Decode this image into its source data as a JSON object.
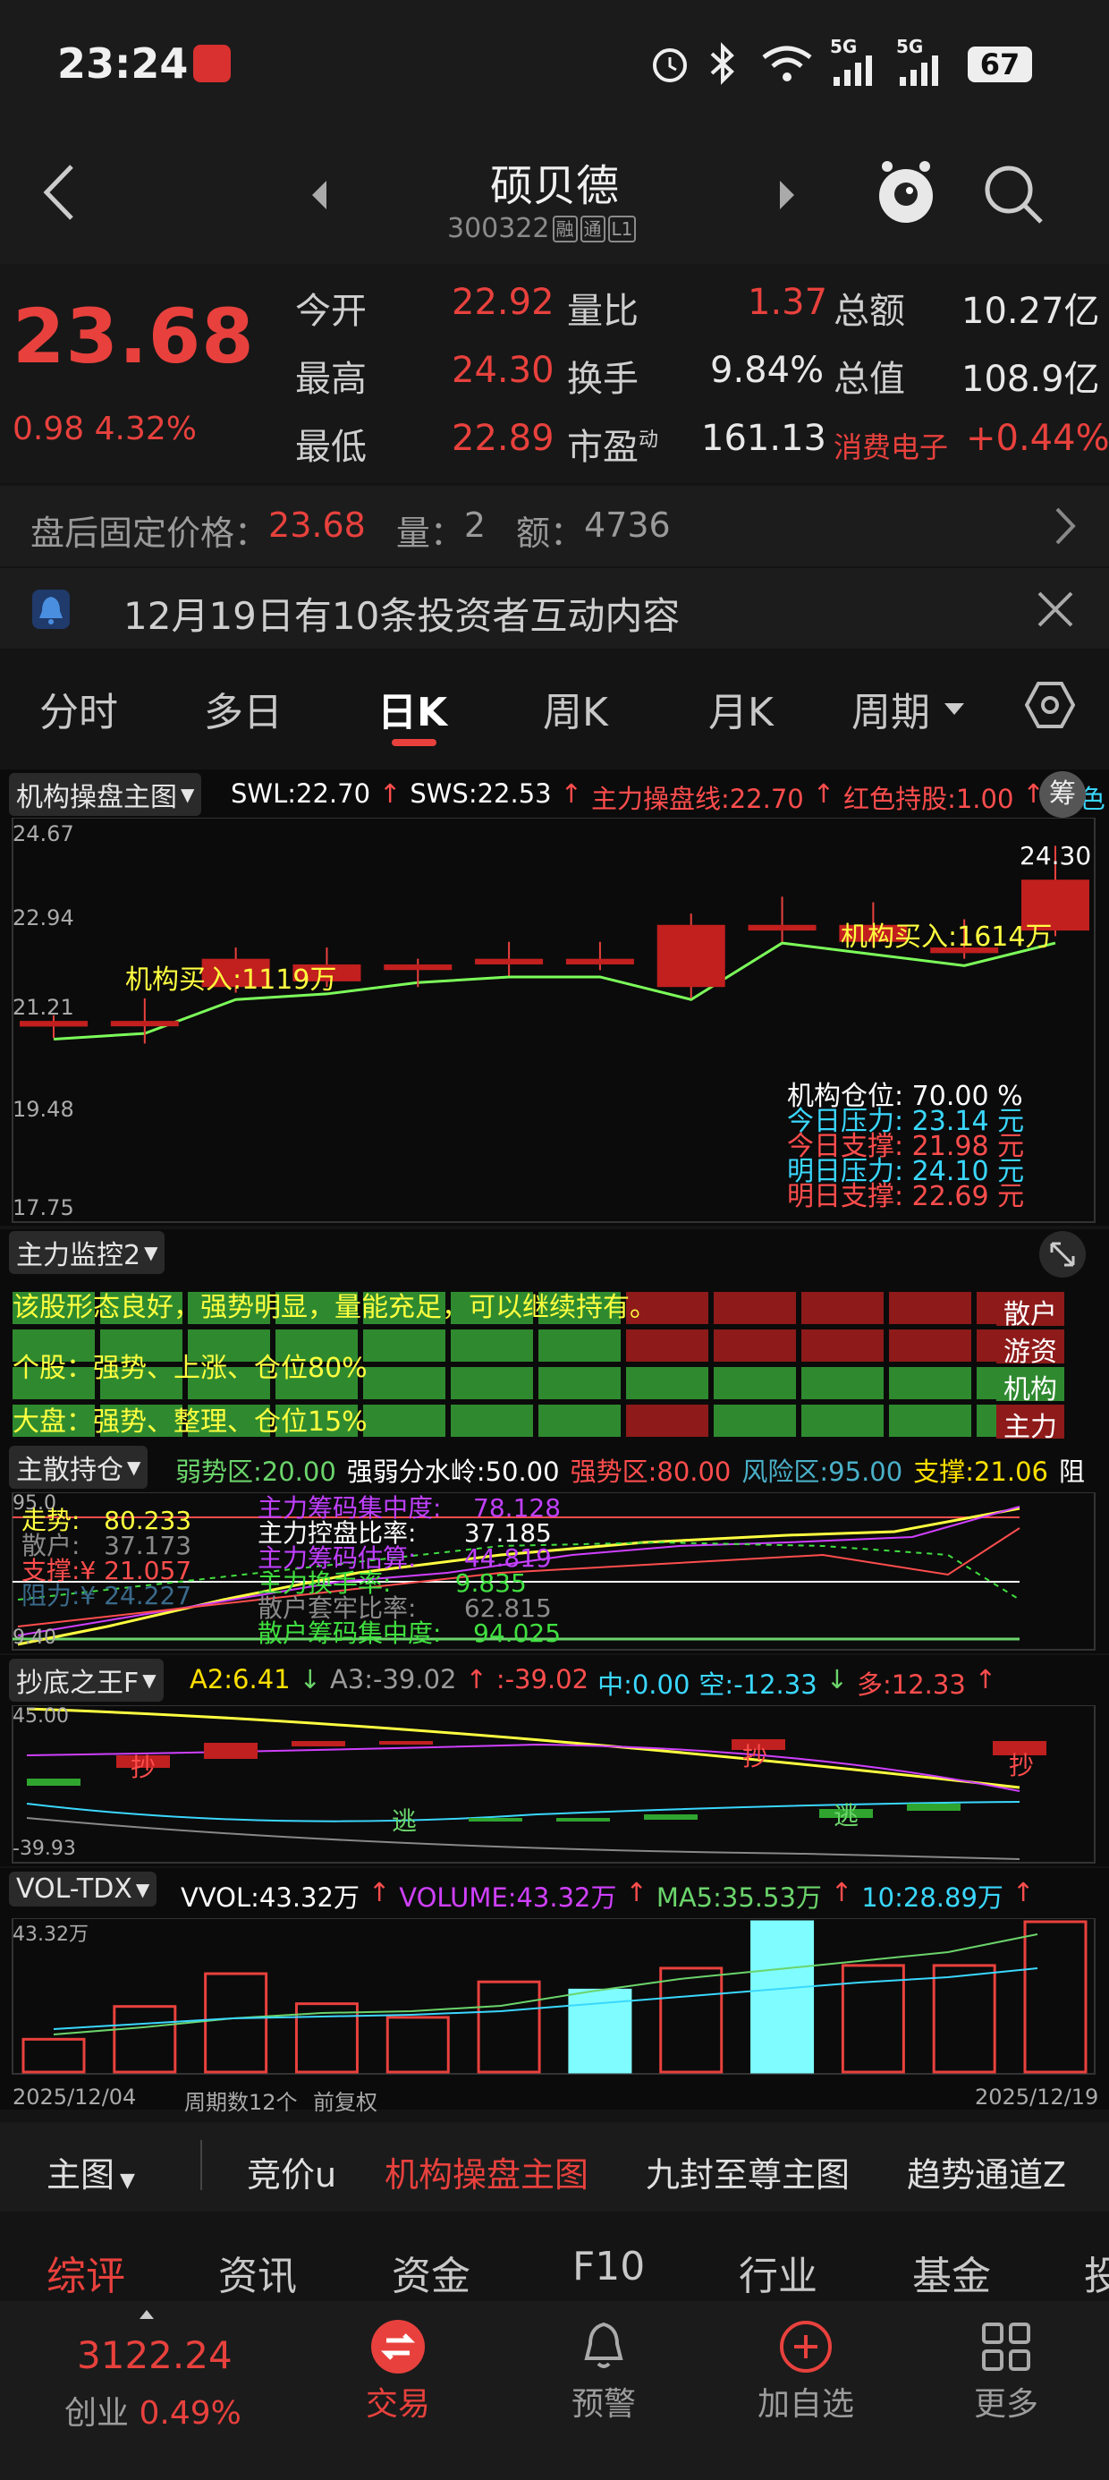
{
  "status_bar": {
    "time": "23:24",
    "battery": "67",
    "net1": "5G",
    "net2": "5G"
  },
  "header": {
    "stock_name": "硕贝德",
    "stock_code": "300322",
    "badges": [
      "融",
      "通",
      "L1"
    ]
  },
  "quote": {
    "price": "23.68",
    "change": "0.98",
    "change_pct": "4.32%",
    "fields": [
      {
        "label": "今开",
        "value": "22.92"
      },
      {
        "label": "量比",
        "value": "1.37"
      },
      {
        "label": "总额",
        "value": "10.27亿"
      },
      {
        "label": "最高",
        "value": "24.30"
      },
      {
        "label": "换手",
        "value": "9.84%"
      },
      {
        "label": "总值",
        "value": "108.9亿"
      },
      {
        "label": "最低",
        "value": "22.89"
      },
      {
        "label": "市盈",
        "value": "161.13"
      },
      {
        "label": "消费电子",
        "value": "+0.44%"
      }
    ],
    "pe_sup": "动"
  },
  "after_hours": {
    "label": "盘后固定价格：",
    "price": "23.68",
    "vol_label": "量：",
    "vol": "2",
    "amt_label": "额：",
    "amt": "4736"
  },
  "notice": {
    "text": "12月19日有10条投资者互动内容"
  },
  "tabs": [
    "分时",
    "多日",
    "日K",
    "周K",
    "月K",
    "周期"
  ],
  "main_chart": {
    "indicator": "机构操盘主图",
    "legend": [
      {
        "text": "SWL:22.70",
        "color": "#ffffff"
      },
      {
        "text": "SWS:22.53",
        "color": "#ffffff"
      },
      {
        "text": "主力操盘线:22.70",
        "color": "#ff4d4d"
      },
      {
        "text": "红色持股:1.00",
        "color": "#ff4d4d"
      },
      {
        "text": "青色",
        "color": "#3ad8ff"
      }
    ],
    "chip_label": "筹",
    "y_ticks": [
      "24.67",
      "22.94",
      "21.21",
      "19.48",
      "17.75"
    ],
    "high_label": "24.30",
    "buy_label_1": "机构买入:1119万",
    "buy_label_2": "机构买入:1614万",
    "info": [
      {
        "label": "机构仓位:",
        "value": "70.00 %",
        "color": "#ffffff"
      },
      {
        "label": "今日压力:",
        "value": "23.14 元",
        "color": "#3ad8ff"
      },
      {
        "label": "今日支撑:",
        "value": "21.98 元",
        "color": "#ff4d4d"
      },
      {
        "label": "明日压力:",
        "value": "24.10 元",
        "color": "#3ad8ff"
      },
      {
        "label": "明日支撑:",
        "value": "22.69 元",
        "color": "#ff4d4d"
      }
    ]
  },
  "chart_data": {
    "type": "candlestick",
    "dates_shown": [
      "2025/12/04",
      "2025/12/19"
    ],
    "period_count_label": "周期数12个",
    "adjust_label": "前复权",
    "ylim": [
      17.75,
      24.67
    ],
    "candles": [
      {
        "o": 21.1,
        "c": 21.2,
        "h": 21.3,
        "l": 20.9
      },
      {
        "o": 21.2,
        "c": 21.2,
        "h": 21.6,
        "l": 20.8
      },
      {
        "o": 21.8,
        "c": 22.3,
        "h": 22.5,
        "l": 21.7
      },
      {
        "o": 21.9,
        "c": 22.2,
        "h": 22.5,
        "l": 21.8
      },
      {
        "o": 22.1,
        "c": 22.2,
        "h": 22.3,
        "l": 21.8
      },
      {
        "o": 22.2,
        "c": 22.3,
        "h": 22.6,
        "l": 22.0
      },
      {
        "o": 22.2,
        "c": 22.3,
        "h": 22.6,
        "l": 22.1
      },
      {
        "o": 21.8,
        "c": 22.9,
        "h": 23.1,
        "l": 21.6
      },
      {
        "o": 22.8,
        "c": 22.9,
        "h": 23.4,
        "l": 22.6
      },
      {
        "o": 22.6,
        "c": 22.9,
        "h": 23.3,
        "l": 22.5
      },
      {
        "o": 22.4,
        "c": 22.5,
        "h": 23.0,
        "l": 22.3
      },
      {
        "o": 22.8,
        "c": 23.7,
        "h": 24.3,
        "l": 22.7
      }
    ],
    "volume": [
      12,
      24,
      36,
      25,
      20,
      33,
      30,
      38,
      55,
      39,
      39,
      55
    ]
  },
  "monitor": {
    "indicator": "主力监控2",
    "text1": "该股形态良好，强势明显，量能充足，可以继续持有。",
    "text2": "个股：强势、上涨、仓位80%",
    "text3": "大盘：强势、整理、仓位15%",
    "labels": [
      "散户",
      "游资",
      "机构",
      "主力"
    ]
  },
  "holdings": {
    "indicator": "主散持仓",
    "legend": [
      {
        "text": "弱势区:20.00",
        "color": "#6bd46b"
      },
      {
        "text": "强弱分水岭:50.00",
        "color": "#ffffff"
      },
      {
        "text": "强势区:80.00",
        "color": "#ff4d4d"
      },
      {
        "text": "风险区:95.00",
        "color": "#4ab0c8"
      },
      {
        "text": "支撑:21.06",
        "color": "#ffe000"
      },
      {
        "text": "阻",
        "color": "#ffffff"
      }
    ],
    "y_top": "95.0",
    "y_bottom": "9.40",
    "rows": [
      {
        "label": "走势:",
        "value": "80.233",
        "color": "#ffff40"
      },
      {
        "label": "散户:",
        "value": "37.173",
        "color": "#8a8a8a"
      },
      {
        "label": "支撑:¥",
        "value": "21.057",
        "color": "#ff4d4d"
      },
      {
        "label": "阻力:¥",
        "value": "24.227",
        "color": "#3a6a8a"
      }
    ],
    "mid": [
      {
        "label": "主力筹码集中度:",
        "value": "78.128",
        "color": "#c040ff"
      },
      {
        "label": "主力控盘比率:",
        "value": "37.185",
        "color": "#ffffff"
      },
      {
        "label": "主力筹码估算:",
        "value": "44.819",
        "color": "#c040ff"
      },
      {
        "label": "主力换手率:",
        "value": "9.835",
        "color": "#40e040"
      },
      {
        "label": "散户套牢比率:",
        "value": "62.815",
        "color": "#8a8a8a"
      },
      {
        "label": "散户筹码集中度:",
        "value": "94.025",
        "color": "#40e040"
      }
    ]
  },
  "bottom_pick": {
    "indicator": "抄底之王F",
    "legend": [
      {
        "text": "A2:6.41",
        "color": "#ffe000"
      },
      {
        "text": "A3:-39.02",
        "color": "#9a9a9a"
      },
      {
        "text": ":-39.02",
        "color": "#ff4d4d"
      },
      {
        "text": "中:0.00",
        "color": "#3ad8ff"
      },
      {
        "text": "空:-12.33",
        "color": "#3ad8ff"
      },
      {
        "text": "多:12.33",
        "color": "#ff4d4d"
      }
    ],
    "y_top": "45.00",
    "y_bottom": "-39.93",
    "buy_mark": "抄",
    "escape_mark": "逃"
  },
  "vol_panel": {
    "indicator": "VOL-TDX",
    "legend": [
      {
        "text": "VVOL:43.32万",
        "color": "#ffffff"
      },
      {
        "text": "VOLUME:43.32万",
        "color": "#d040ff"
      },
      {
        "text": "MA5:35.53万",
        "color": "#6bd46b"
      },
      {
        "text": "10:28.89万",
        "color": "#3ad8ff"
      }
    ],
    "y_top": "43.32万"
  },
  "chart_tools": [
    "主图",
    "竞价u",
    "机构操盘主图",
    "九封至尊主图",
    "趋势通道Z"
  ],
  "info_tabs": [
    "综评",
    "资讯",
    "资金",
    "F10",
    "行业",
    "基金",
    "投"
  ],
  "bottom_nav": {
    "index_value": "3122.24",
    "index_name": "创业",
    "index_pct": "0.49%",
    "items": [
      "交易",
      "预警",
      "加自选",
      "更多"
    ]
  }
}
